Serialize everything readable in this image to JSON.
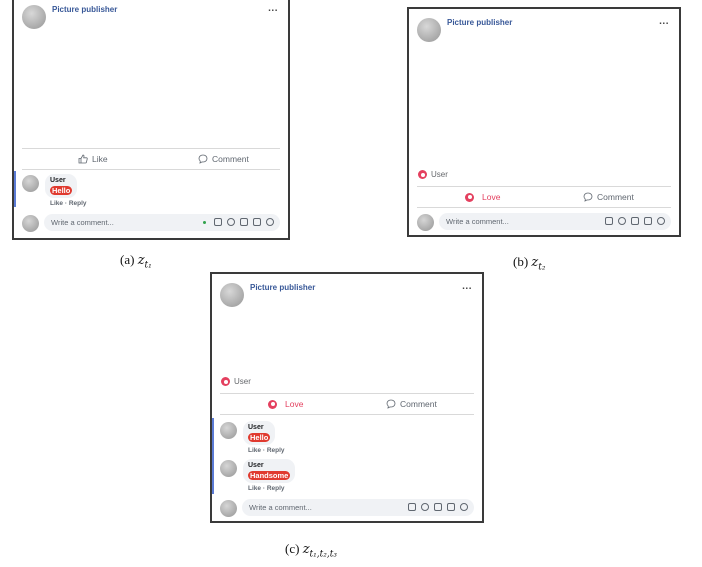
{
  "colors": {
    "accent_blue": "#385898",
    "love_red": "#e4405f",
    "comment_highlight": "#e03a2f",
    "thread_bar": "#5b7bd5"
  },
  "panels": {
    "a": {
      "publisher": "Picture publisher",
      "more": "...",
      "actions": {
        "like": "Like",
        "comment": "Comment"
      },
      "comments": [
        {
          "user": "User",
          "text": "Hello",
          "like": "Like",
          "sep": "·",
          "reply": "Reply"
        }
      ],
      "write_placeholder": "Write a comment...",
      "caption": {
        "prefix": "(a)",
        "var": "z",
        "sub": "t₁"
      }
    },
    "b": {
      "publisher": "Picture publisher",
      "more": "...",
      "reaction_user": "User",
      "actions": {
        "love": "Love",
        "comment": "Comment"
      },
      "write_placeholder": "Write a comment...",
      "caption": {
        "prefix": "(b)",
        "var": "z",
        "sub": "t₂"
      }
    },
    "c": {
      "publisher": "Picture publisher",
      "more": "...",
      "reaction_user": "User",
      "actions": {
        "love": "Love",
        "comment": "Comment"
      },
      "comments": [
        {
          "user": "User",
          "text": "Hello",
          "like": "Like",
          "sep": "·",
          "reply": "Reply"
        },
        {
          "user": "User",
          "text": "Handsome",
          "like": "Like",
          "sep": "·",
          "reply": "Reply"
        }
      ],
      "write_placeholder": "Write a comment...",
      "caption": {
        "prefix": "(c)",
        "var": "z",
        "sub": "t₁,t₂,t₃"
      }
    }
  }
}
